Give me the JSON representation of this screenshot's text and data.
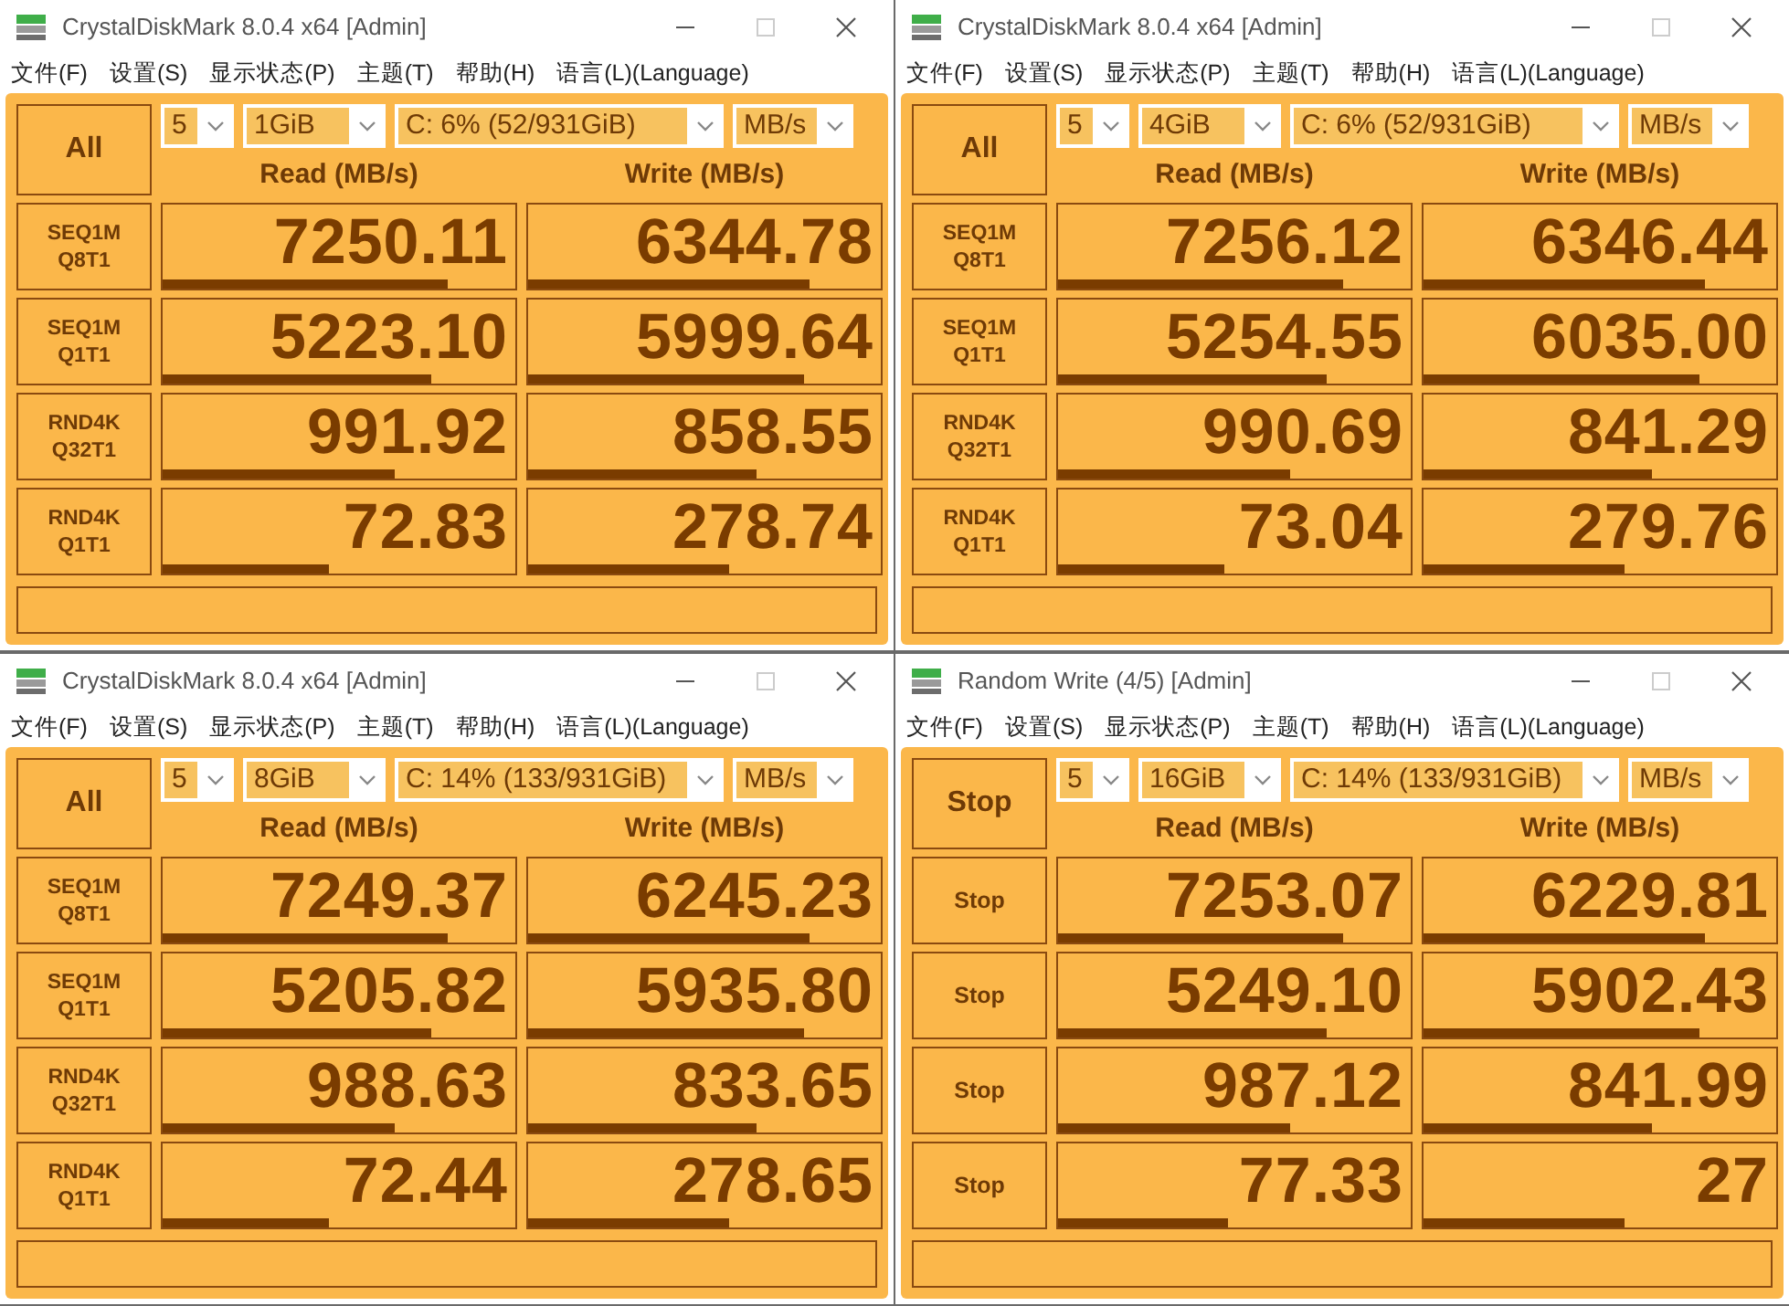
{
  "windows": [
    {
      "title": "CrystalDiskMark 8.0.4 x64 [Admin]",
      "menu": [
        "文件(F)",
        "设置(S)",
        "显示状态(P)",
        "主题(T)",
        "帮助(H)",
        "语言(L)(Language)"
      ],
      "action": "All",
      "count": "5",
      "size": "1GiB",
      "drive": "C: 6% (52/931GiB)",
      "unit": "MB/s",
      "read_header": "Read (MB/s)",
      "write_header": "Write (MB/s)",
      "rows": [
        {
          "test": [
            "SEQ1M",
            "Q8T1"
          ],
          "read": {
            "value": "7250.11",
            "level": 0.81
          },
          "write": {
            "value": "6344.78",
            "level": 0.8
          }
        },
        {
          "test": [
            "SEQ1M",
            "Q1T1"
          ],
          "read": {
            "value": "5223.10",
            "level": 0.76
          },
          "write": {
            "value": "5999.64",
            "level": 0.78
          }
        },
        {
          "test": [
            "RND4K",
            "Q32T1"
          ],
          "read": {
            "value": "991.92",
            "level": 0.66
          },
          "write": {
            "value": "858.55",
            "level": 0.65
          }
        },
        {
          "test": [
            "RND4K",
            "Q1T1"
          ],
          "read": {
            "value": "72.83",
            "level": 0.47
          },
          "write": {
            "value": "278.74",
            "level": 0.57
          }
        }
      ]
    },
    {
      "title": "CrystalDiskMark 8.0.4 x64 [Admin]",
      "menu": [
        "文件(F)",
        "设置(S)",
        "显示状态(P)",
        "主题(T)",
        "帮助(H)",
        "语言(L)(Language)"
      ],
      "action": "All",
      "count": "5",
      "size": "4GiB",
      "drive": "C: 6% (52/931GiB)",
      "unit": "MB/s",
      "read_header": "Read (MB/s)",
      "write_header": "Write (MB/s)",
      "rows": [
        {
          "test": [
            "SEQ1M",
            "Q8T1"
          ],
          "read": {
            "value": "7256.12",
            "level": 0.81
          },
          "write": {
            "value": "6346.44",
            "level": 0.8
          }
        },
        {
          "test": [
            "SEQ1M",
            "Q1T1"
          ],
          "read": {
            "value": "5254.55",
            "level": 0.76
          },
          "write": {
            "value": "6035.00",
            "level": 0.78
          }
        },
        {
          "test": [
            "RND4K",
            "Q32T1"
          ],
          "read": {
            "value": "990.69",
            "level": 0.66
          },
          "write": {
            "value": "841.29",
            "level": 0.65
          }
        },
        {
          "test": [
            "RND4K",
            "Q1T1"
          ],
          "read": {
            "value": "73.04",
            "level": 0.47
          },
          "write": {
            "value": "279.76",
            "level": 0.57
          }
        }
      ]
    },
    {
      "title": "CrystalDiskMark 8.0.4 x64 [Admin]",
      "menu": [
        "文件(F)",
        "设置(S)",
        "显示状态(P)",
        "主题(T)",
        "帮助(H)",
        "语言(L)(Language)"
      ],
      "action": "All",
      "count": "5",
      "size": "8GiB",
      "drive": "C: 14% (133/931GiB)",
      "unit": "MB/s",
      "read_header": "Read (MB/s)",
      "write_header": "Write (MB/s)",
      "rows": [
        {
          "test": [
            "SEQ1M",
            "Q8T1"
          ],
          "read": {
            "value": "7249.37",
            "level": 0.81
          },
          "write": {
            "value": "6245.23",
            "level": 0.8
          }
        },
        {
          "test": [
            "SEQ1M",
            "Q1T1"
          ],
          "read": {
            "value": "5205.82",
            "level": 0.76
          },
          "write": {
            "value": "5935.80",
            "level": 0.78
          }
        },
        {
          "test": [
            "RND4K",
            "Q32T1"
          ],
          "read": {
            "value": "988.63",
            "level": 0.66
          },
          "write": {
            "value": "833.65",
            "level": 0.65
          }
        },
        {
          "test": [
            "RND4K",
            "Q1T1"
          ],
          "read": {
            "value": "72.44",
            "level": 0.47
          },
          "write": {
            "value": "278.65",
            "level": 0.57
          }
        }
      ]
    },
    {
      "title": "Random Write (4/5) [Admin]",
      "menu": [
        "文件(F)",
        "设置(S)",
        "显示状态(P)",
        "主题(T)",
        "帮助(H)",
        "语言(L)(Language)"
      ],
      "action": "Stop",
      "count": "5",
      "size": "16GiB",
      "drive": "C: 14% (133/931GiB)",
      "unit": "MB/s",
      "read_header": "Read (MB/s)",
      "write_header": "Write (MB/s)",
      "rows": [
        {
          "test": [
            "Stop"
          ],
          "read": {
            "value": "7253.07",
            "level": 0.81
          },
          "write": {
            "value": "6229.81",
            "level": 0.8
          }
        },
        {
          "test": [
            "Stop"
          ],
          "read": {
            "value": "5249.10",
            "level": 0.76
          },
          "write": {
            "value": "5902.43",
            "level": 0.78
          }
        },
        {
          "test": [
            "Stop"
          ],
          "read": {
            "value": "987.12",
            "level": 0.66
          },
          "write": {
            "value": "841.99",
            "level": 0.65
          }
        },
        {
          "test": [
            "Stop"
          ],
          "read": {
            "value": "77.33",
            "level": 0.48
          },
          "write": {
            "value": "27",
            "level": 0.57
          }
        }
      ]
    }
  ]
}
